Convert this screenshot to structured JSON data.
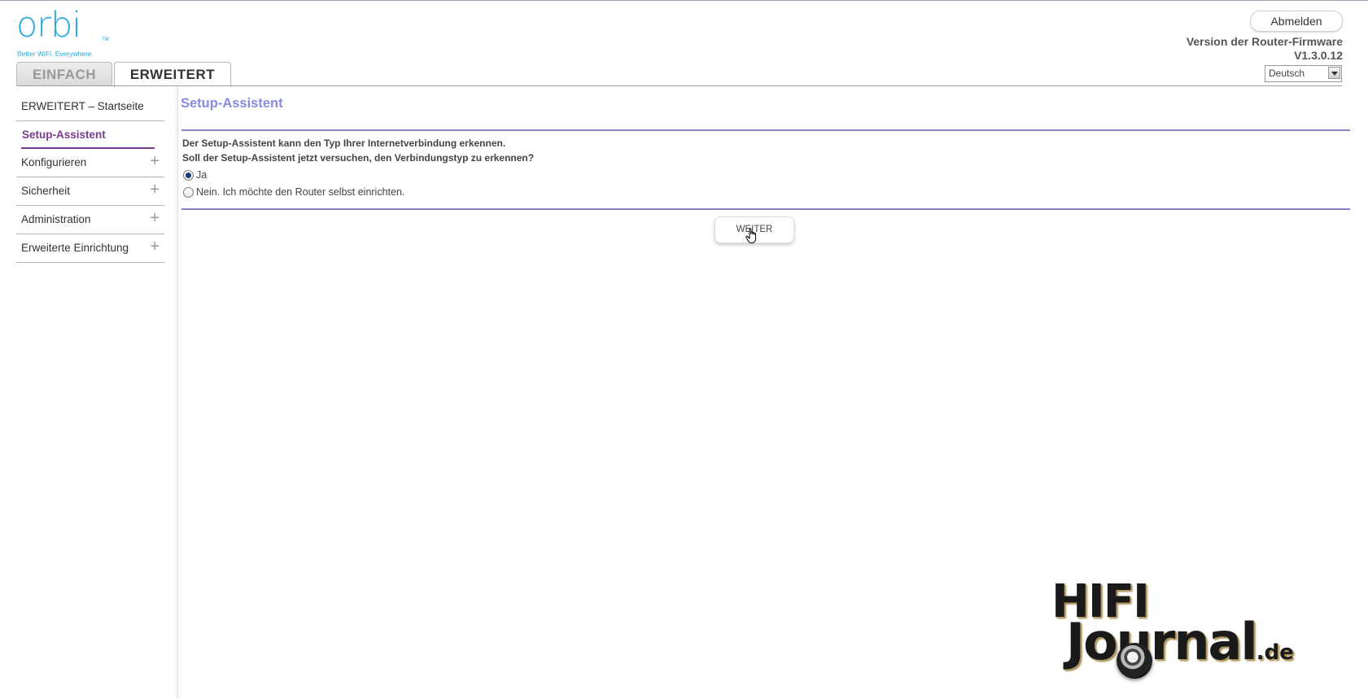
{
  "header": {
    "logo_text": "orbi",
    "logo_tm": "TM",
    "logo_tagline": "Better WiFi. Everywhere.",
    "logout_label": "Abmelden",
    "firmware_label": "Version der Router-Firmware",
    "firmware_version": "V1.3.0.12",
    "language": {
      "selected": "Deutsch"
    }
  },
  "tabs": [
    {
      "label": "EINFACH",
      "active": false
    },
    {
      "label": "ERWEITERT",
      "active": true
    }
  ],
  "sidebar": {
    "items": [
      {
        "label": "ERWEITERT – Startseite",
        "expandable": false,
        "active": false
      },
      {
        "label": "Setup-Assistent",
        "expandable": false,
        "active": true
      },
      {
        "label": "Konfigurieren",
        "expandable": true,
        "active": false
      },
      {
        "label": "Sicherheit",
        "expandable": true,
        "active": false
      },
      {
        "label": "Administration",
        "expandable": true,
        "active": false
      },
      {
        "label": "Erweiterte Einrichtung",
        "expandable": true,
        "active": false
      }
    ],
    "expand_symbol": "+"
  },
  "main": {
    "title": "Setup-Assistent",
    "description_1": "Der Setup-Assistent kann den Typ Ihrer Internetverbindung erkennen.",
    "description_2": "Soll der Setup-Assistent jetzt versuchen, den Verbindungstyp zu erkennen?",
    "options": [
      {
        "label": "Ja",
        "checked": true
      },
      {
        "label": "Nein. Ich möchte den Router selbst einrichten.",
        "checked": false
      }
    ],
    "next_button_label": "WEITER"
  },
  "watermark": {
    "line1": "HIFI",
    "line2": "Journal",
    "suffix": ".de"
  },
  "colors": {
    "brand": "#27a9df",
    "title": "#8a8ae0",
    "active_link": "#7a3b8c",
    "divider": "#8f7fc6"
  }
}
